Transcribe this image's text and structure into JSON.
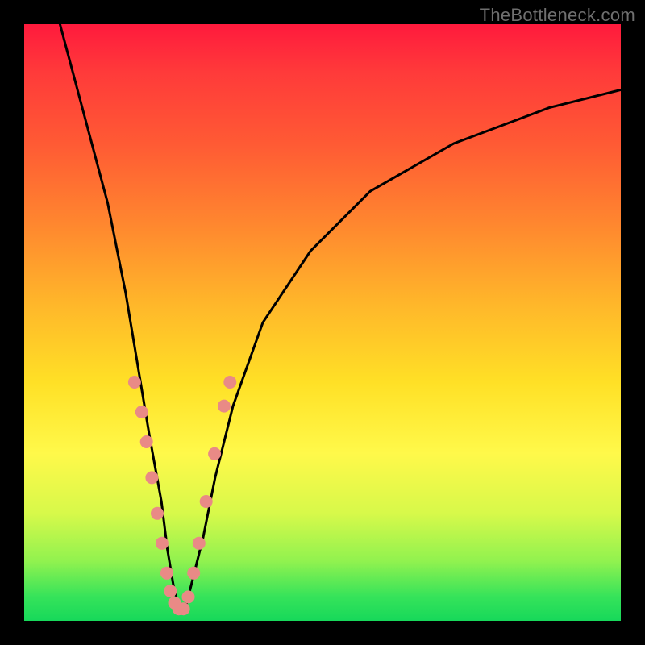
{
  "watermark": "TheBottleneck.com",
  "chart_data": {
    "type": "line",
    "title": "",
    "xlabel": "",
    "ylabel": "",
    "xlim": [
      0,
      100
    ],
    "ylim": [
      0,
      100
    ],
    "series": [
      {
        "name": "bottleneck-curve",
        "x": [
          6,
          10,
          14,
          17,
          19,
          21,
          23,
          24,
          25,
          26,
          27,
          28,
          30,
          32,
          35,
          40,
          48,
          58,
          72,
          88,
          100
        ],
        "y": [
          100,
          85,
          70,
          55,
          43,
          31,
          20,
          12,
          6,
          2,
          2,
          6,
          14,
          24,
          36,
          50,
          62,
          72,
          80,
          86,
          89
        ]
      }
    ],
    "markers": {
      "name": "highlight-dots",
      "color": "#e98a86",
      "radius_px": 8,
      "x": [
        18.5,
        19.7,
        20.5,
        21.4,
        22.3,
        23.1,
        23.9,
        24.5,
        25.2,
        25.9,
        26.7,
        27.5,
        28.4,
        29.3,
        30.5,
        31.9,
        33.5,
        34.5
      ],
      "y": [
        40,
        35,
        30,
        24,
        18,
        13,
        8,
        5,
        3,
        2,
        2,
        4,
        8,
        13,
        20,
        28,
        36,
        40
      ]
    },
    "gradient_meaning": "red=top (bad), green=bottom (good)"
  }
}
